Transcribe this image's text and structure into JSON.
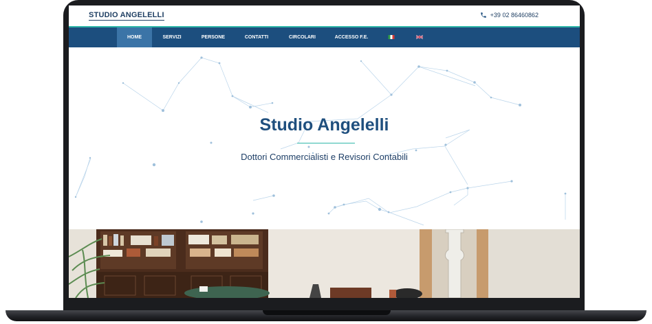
{
  "site": {
    "logo": "STUDIO ANGELELLI",
    "phone": "+39 02 86460862"
  },
  "nav": {
    "items": [
      {
        "label": "HOME",
        "active": true
      },
      {
        "label": "SERVIZI",
        "active": false
      },
      {
        "label": "PERSONE",
        "active": false
      },
      {
        "label": "CONTATTI",
        "active": false
      },
      {
        "label": "CIRCOLARI",
        "active": false
      },
      {
        "label": "ACCESSO F.E.",
        "active": false
      }
    ],
    "languages": [
      "it-flag",
      "uk-flag"
    ]
  },
  "hero": {
    "title": "Studio Angelelli",
    "subtitle": "Dottori Commercialisti e Revisori Contabili"
  },
  "colors": {
    "brand": "#1f4f7e",
    "nav": "#1c4e7e",
    "nav_active": "#3b74a7",
    "accent": "#2fb7a9"
  },
  "icons": [
    "phone-icon"
  ]
}
